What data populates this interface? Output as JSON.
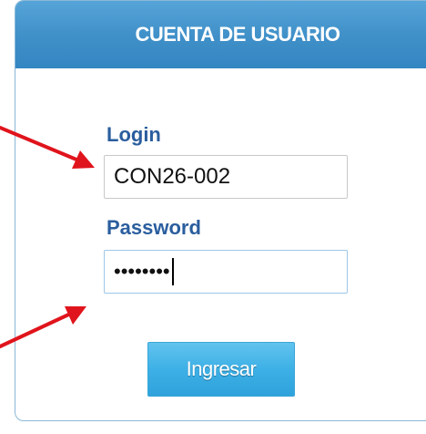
{
  "panel": {
    "header_title": "CUENTA DE USUARIO"
  },
  "form": {
    "login_label": "Login",
    "login_value": "CON26-002",
    "password_label": "Password",
    "password_masked": "••••••••",
    "submit_label": "Ingresar"
  },
  "colors": {
    "header": "#3f8fc8",
    "label": "#2a5e9e",
    "button": "#3db0e6",
    "annotation_arrow": "#e0141c"
  },
  "annotations": {
    "arrows": [
      "arrow-to-login-field",
      "arrow-to-password-field"
    ]
  }
}
